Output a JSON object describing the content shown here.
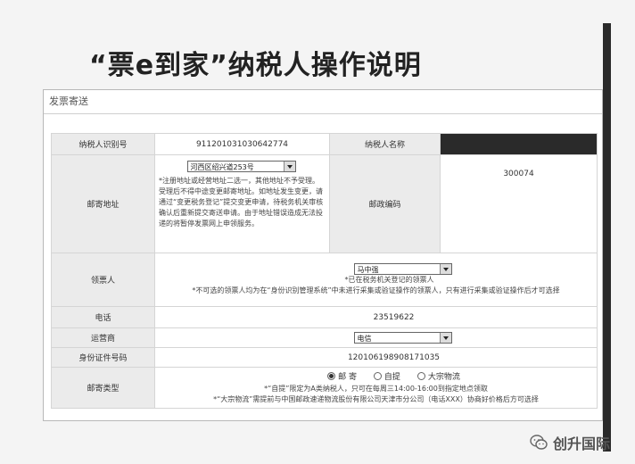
{
  "page_title": "“票e到家”纳税人操作说明",
  "form": {
    "header": "发票寄送",
    "taxpayer_id_label": "纳税人识别号",
    "taxpayer_id_value": "911201031030642774",
    "taxpayer_name_label": "纳税人名称",
    "mail_address_label": "邮寄地址",
    "address_select_value": "河西区绍兴道253号",
    "address_note": "*注册地址或经营地址二选一，其他地址不予受理。受理后不得中途变更邮寄地址。如地址发生变更，请通过“变更税务登记”提交变更申请，待税务机关审核确认后重新提交寄送申请。由于地址错误造成无法投递的将暂停发票网上申领服务。",
    "postal_code_label": "邮政编码",
    "postal_code_value": "300074",
    "recipient_label": "领票人",
    "recipient_select_value": "马中强",
    "recipient_note_1": "*已在税务机关登记的领票人",
    "recipient_note_2": "*不可选的领票人均为在“身份识别管理系统”中未进行采集或验证操作的领票人，只有进行采集或验证操作后才可选择",
    "phone_label": "电话",
    "phone_value": "23519622",
    "carrier_label": "运营商",
    "carrier_select_value": "电信",
    "id_number_label": "身份证件号码",
    "id_number_value": "120106198908171035",
    "mail_type_label": "邮寄类型",
    "mail_type_options": [
      "邮 寄",
      "自提",
      "大宗物流"
    ],
    "mail_type_note_1": "*“自提”限定为A类纳税人，只可在每周三14:00-16:00到指定地点领取",
    "mail_type_note_2": "*“大宗物流”需提前与中国邮政速递物流股份有限公司天津市分公司（电话XXX）协商好价格后方可选择"
  },
  "watermark": "创升国际"
}
